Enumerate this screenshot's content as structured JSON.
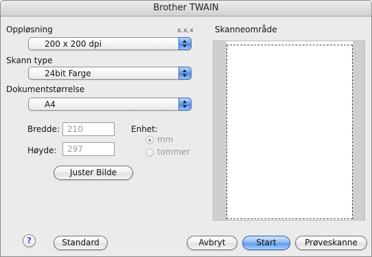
{
  "window": {
    "title": "Brother TWAIN"
  },
  "resolution": {
    "label": "Oppløsning",
    "version": "x.x.x",
    "selected": "200 x 200 dpi"
  },
  "scan_type": {
    "label": "Skann type",
    "selected": "24bit Farge"
  },
  "document_size": {
    "label": "Dokumentstørrelse",
    "selected": "A4"
  },
  "dimensions": {
    "width_label": "Bredde:",
    "width_value": "210",
    "height_label": "Høyde:",
    "height_value": "297"
  },
  "unit": {
    "label": "Enhet:",
    "options": [
      "mm",
      "tommer"
    ],
    "selected": "mm"
  },
  "adjust_button": "Juster Bilde",
  "scan_area": {
    "label": "Skanneområde"
  },
  "footer": {
    "help_symbol": "?",
    "standard": "Standard",
    "cancel": "Avbryt",
    "start": "Start",
    "preview": "Prøveskanne"
  },
  "colors": {
    "default_button": "#5f9bec",
    "window_bg": "#ebebeb",
    "scan_area_bg": "#cfcfcf"
  }
}
